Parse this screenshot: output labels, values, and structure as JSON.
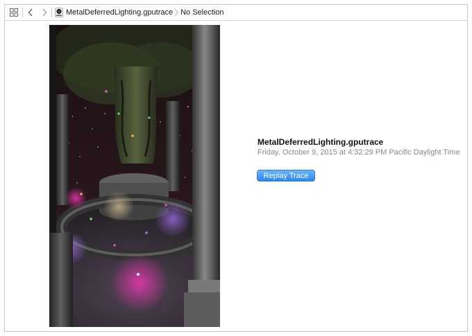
{
  "toolbar": {
    "grid_icon": "grid-icon",
    "back_icon": "chevron-left-icon",
    "forward_icon": "chevron-right-icon"
  },
  "breadcrumb": {
    "file_icon": "gputrace-document-icon",
    "file_name": "MetalDeferredLighting.gputrace",
    "separator_icon": "chevron-right-icon",
    "selection": "No Selection"
  },
  "trace": {
    "thumbnail_icon": "trace-thumbnail-image",
    "title": "MetalDeferredLighting.gputrace",
    "date": "Friday, October 9, 2015 at 4:32:29 PM Pacific Daylight Time"
  },
  "actions": {
    "replay_label": "Replay Trace"
  },
  "colors": {
    "accent": "#2a86f0",
    "secondary_text": "#8a8a8a"
  }
}
